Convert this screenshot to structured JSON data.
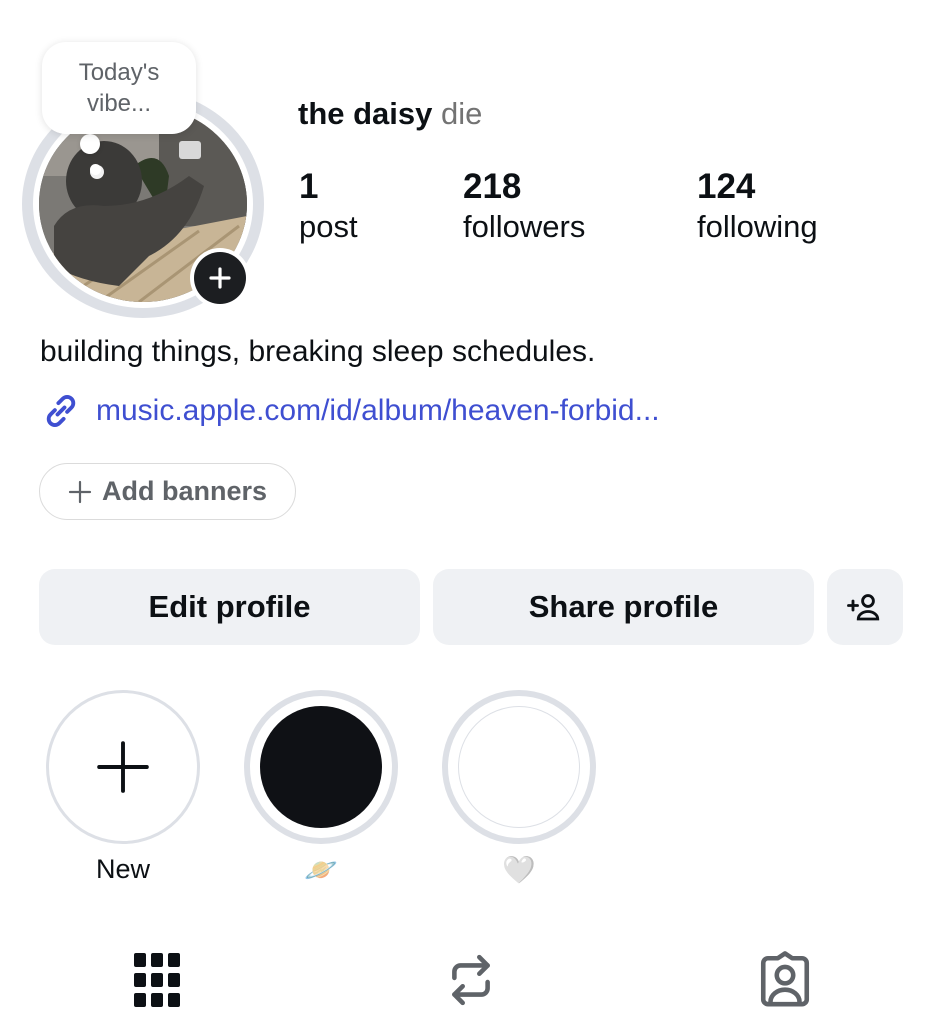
{
  "profile": {
    "note": [
      "Today's",
      "vibe..."
    ],
    "name": "the daisy",
    "pronouns": "die"
  },
  "stats": [
    {
      "value": "1",
      "label": "post"
    },
    {
      "value": "218",
      "label": "followers"
    },
    {
      "value": "124",
      "label": "following"
    }
  ],
  "bio": {
    "text": "building things, breaking sleep schedules.",
    "link": "music.apple.com/id/album/heaven-forbid..."
  },
  "banners": {
    "label": "Add banners"
  },
  "actions": {
    "edit": "Edit profile",
    "share": "Share profile"
  },
  "highlights": [
    {
      "label": "New"
    },
    {
      "label": "🪐"
    },
    {
      "label": "🤍"
    }
  ],
  "tabs": [
    "grid-icon",
    "reposts-icon",
    "tagged-icon"
  ],
  "colors": {
    "link": "#3f4fd1",
    "button_bg": "#eff1f4",
    "ring": "#dde0e6",
    "text": "#0c1014"
  }
}
